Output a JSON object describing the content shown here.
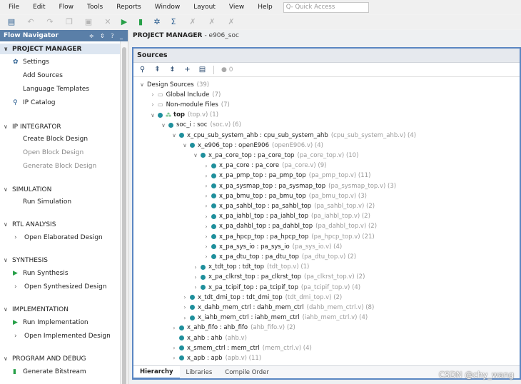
{
  "menu": [
    "File",
    "Edit",
    "Flow",
    "Tools",
    "Reports",
    "Window",
    "Layout",
    "View",
    "Help"
  ],
  "quick_access": "Q- Quick Access",
  "flow_navigator": {
    "title": "Flow Navigator",
    "controls": "≑ ⇕ ? _",
    "sections": [
      {
        "label": "PROJECT MANAGER",
        "selected": true,
        "items": [
          {
            "label": "Settings",
            "icon": "gear-icon"
          },
          {
            "label": "Add Sources"
          },
          {
            "label": "Language Templates"
          },
          {
            "label": "IP Catalog",
            "icon": "ip-icon"
          }
        ]
      },
      {
        "label": "IP INTEGRATOR",
        "items": [
          {
            "label": "Create Block Design"
          },
          {
            "label": "Open Block Design",
            "dim": true
          },
          {
            "label": "Generate Block Design",
            "dim": true
          }
        ]
      },
      {
        "label": "SIMULATION",
        "items": [
          {
            "label": "Run Simulation"
          }
        ]
      },
      {
        "label": "RTL ANALYSIS",
        "items": [
          {
            "label": "Open Elaborated Design",
            "expand": true
          }
        ]
      },
      {
        "label": "SYNTHESIS",
        "items": [
          {
            "label": "Run Synthesis",
            "icon": "run-icon"
          },
          {
            "label": "Open Synthesized Design",
            "expand": true
          }
        ]
      },
      {
        "label": "IMPLEMENTATION",
        "items": [
          {
            "label": "Run Implementation",
            "icon": "run-icon"
          },
          {
            "label": "Open Implemented Design",
            "expand": true
          }
        ]
      },
      {
        "label": "PROGRAM AND DEBUG",
        "items": [
          {
            "label": "Generate Bitstream",
            "icon": "bitstream-icon"
          }
        ]
      }
    ]
  },
  "project_manager": {
    "title": "PROJECT MANAGER",
    "project": "- e906_soc"
  },
  "sources": {
    "title": "Sources",
    "badge": "0",
    "tree": [
      {
        "d": 0,
        "tw": "v",
        "ic": "none",
        "name": "Design Sources",
        "file": "(39)"
      },
      {
        "d": 1,
        "tw": ">",
        "ic": "folder",
        "name": "Global Include",
        "file": "(7)"
      },
      {
        "d": 1,
        "tw": ">",
        "ic": "folder",
        "name": "Non-module Files",
        "file": "(7)"
      },
      {
        "d": 1,
        "tw": "v",
        "ic": "top",
        "name": "top",
        "file": "(top.v) (1)",
        "bold": true
      },
      {
        "d": 2,
        "tw": "v",
        "ic": "dot",
        "name": "soc_i : soc",
        "file": "(soc.v) (6)"
      },
      {
        "d": 3,
        "tw": "v",
        "ic": "dot",
        "name": "x_cpu_sub_system_ahb : cpu_sub_system_ahb",
        "file": "(cpu_sub_system_ahb.v) (4)"
      },
      {
        "d": 4,
        "tw": "v",
        "ic": "dot",
        "name": "x_e906_top : openE906",
        "file": "(openE906.v) (4)"
      },
      {
        "d": 5,
        "tw": "v",
        "ic": "dot",
        "name": "x_pa_core_top : pa_core_top",
        "file": "(pa_core_top.v) (10)"
      },
      {
        "d": 6,
        "tw": ">",
        "ic": "dot",
        "name": "x_pa_core : pa_core",
        "file": "(pa_core.v) (9)"
      },
      {
        "d": 6,
        "tw": ">",
        "ic": "dot",
        "name": "x_pa_pmp_top : pa_pmp_top",
        "file": "(pa_pmp_top.v) (11)"
      },
      {
        "d": 6,
        "tw": ">",
        "ic": "dot",
        "name": "x_pa_sysmap_top : pa_sysmap_top",
        "file": "(pa_sysmap_top.v) (3)"
      },
      {
        "d": 6,
        "tw": ">",
        "ic": "dot",
        "name": "x_pa_bmu_top : pa_bmu_top",
        "file": "(pa_bmu_top.v) (3)"
      },
      {
        "d": 6,
        "tw": ">",
        "ic": "dot",
        "name": "x_pa_sahbl_top : pa_sahbl_top",
        "file": "(pa_sahbl_top.v) (2)"
      },
      {
        "d": 6,
        "tw": ">",
        "ic": "dot",
        "name": "x_pa_iahbl_top : pa_iahbl_top",
        "file": "(pa_iahbl_top.v) (2)"
      },
      {
        "d": 6,
        "tw": ">",
        "ic": "dot",
        "name": "x_pa_dahbl_top : pa_dahbl_top",
        "file": "(pa_dahbl_top.v) (2)"
      },
      {
        "d": 6,
        "tw": ">",
        "ic": "dot",
        "name": "x_pa_hpcp_top : pa_hpcp_top",
        "file": "(pa_hpcp_top.v) (21)"
      },
      {
        "d": 6,
        "tw": ">",
        "ic": "dot",
        "name": "x_pa_sys_io : pa_sys_io",
        "file": "(pa_sys_io.v) (4)"
      },
      {
        "d": 6,
        "tw": ">",
        "ic": "dot",
        "name": "x_pa_dtu_top : pa_dtu_top",
        "file": "(pa_dtu_top.v) (2)"
      },
      {
        "d": 5,
        "tw": ">",
        "ic": "dot",
        "name": "x_tdt_top : tdt_top",
        "file": "(tdt_top.v) (1)"
      },
      {
        "d": 5,
        "tw": ">",
        "ic": "dot",
        "name": "x_pa_clkrst_top : pa_clkrst_top",
        "file": "(pa_clkrst_top.v) (2)"
      },
      {
        "d": 5,
        "tw": ">",
        "ic": "dot",
        "name": "x_pa_tcipif_top : pa_tcipif_top",
        "file": "(pa_tcipif_top.v) (4)"
      },
      {
        "d": 4,
        "tw": ">",
        "ic": "dot",
        "name": "x_tdt_dmi_top : tdt_dmi_top",
        "file": "(tdt_dmi_top.v) (2)"
      },
      {
        "d": 4,
        "tw": ">",
        "ic": "dot",
        "name": "x_dahb_mem_ctrl : dahb_mem_ctrl",
        "file": "(dahb_mem_ctrl.v) (8)"
      },
      {
        "d": 4,
        "tw": ">",
        "ic": "dot",
        "name": "x_iahb_mem_ctrl : iahb_mem_ctrl",
        "file": "(iahb_mem_ctrl.v) (4)"
      },
      {
        "d": 3,
        "tw": ">",
        "ic": "dot",
        "name": "x_ahb_fifo : ahb_fifo",
        "file": "(ahb_fifo.v) (2)"
      },
      {
        "d": 3,
        "tw": "",
        "ic": "dot",
        "name": "x_ahb : ahb",
        "file": "(ahb.v)"
      },
      {
        "d": 3,
        "tw": ">",
        "ic": "dot",
        "name": "x_smem_ctrl : mem_ctrl",
        "file": "(mem_ctrl.v) (4)"
      },
      {
        "d": 3,
        "tw": ">",
        "ic": "dot",
        "name": "x_apb : apb",
        "file": "(apb.v) (11)"
      }
    ],
    "tabs": [
      "Hierarchy",
      "Libraries",
      "Compile Order"
    ]
  },
  "watermark": "CSDN @chy_wang"
}
